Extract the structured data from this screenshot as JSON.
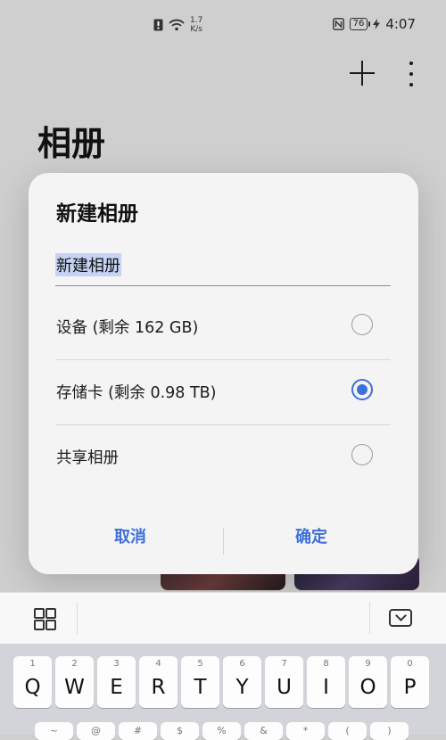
{
  "status_bar": {
    "network_speed_value": "1.7",
    "network_speed_unit": "K/s",
    "battery_level": "76",
    "time": "4:07"
  },
  "app": {
    "title": "相册"
  },
  "dialog": {
    "title": "新建相册",
    "name_value": "新建相册",
    "options": [
      {
        "label": "设备 (剩余 162 GB)",
        "selected": false
      },
      {
        "label": "存储卡 (剩余 0.98 TB)",
        "selected": true
      },
      {
        "label": "共享相册",
        "selected": false
      }
    ],
    "cancel_label": "取消",
    "confirm_label": "确定"
  },
  "keyboard": {
    "row1": [
      {
        "num": "1",
        "letter": "Q"
      },
      {
        "num": "2",
        "letter": "W"
      },
      {
        "num": "3",
        "letter": "E"
      },
      {
        "num": "4",
        "letter": "R"
      },
      {
        "num": "5",
        "letter": "T"
      },
      {
        "num": "6",
        "letter": "Y"
      },
      {
        "num": "7",
        "letter": "U"
      },
      {
        "num": "8",
        "letter": "I"
      },
      {
        "num": "9",
        "letter": "O"
      },
      {
        "num": "0",
        "letter": "P"
      }
    ],
    "row2_symbols": [
      "~",
      "@",
      "#",
      "$",
      "%",
      "&",
      "*",
      "(",
      ")"
    ]
  },
  "colors": {
    "accent": "#3f6fd8",
    "background": "#cfcfcf",
    "dialog": "#f4f4f4"
  }
}
